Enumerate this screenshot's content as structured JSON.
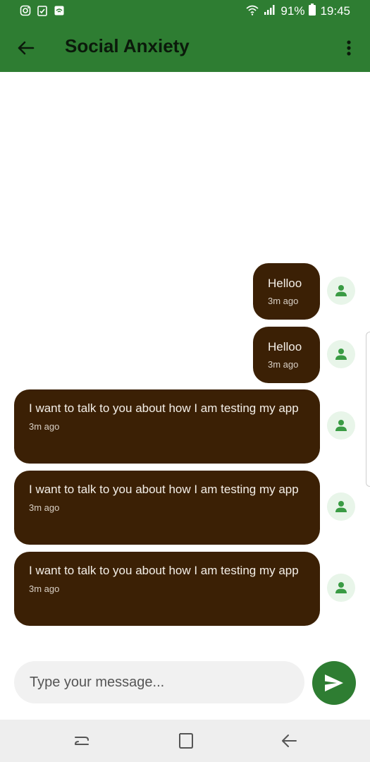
{
  "status_bar": {
    "left_icons": [
      "instagram-icon",
      "clipboard-icon",
      "message-icon"
    ],
    "battery": "91%",
    "time": "19:45"
  },
  "app_bar": {
    "title": "Social Anxiety",
    "back_icon": "arrow-left-icon",
    "menu_icon": "more-vert-icon",
    "color": "#2e7d32"
  },
  "messages": [
    {
      "text": "Helloo",
      "time": "3m ago"
    },
    {
      "text": "Helloo",
      "time": "3m ago"
    },
    {
      "text": "I want to talk to you about how I am testing my app",
      "time": "3m ago"
    },
    {
      "text": "I want to talk to you about how I am testing my app",
      "time": "3m ago"
    },
    {
      "text": "I want to talk to you about how I am testing my app",
      "time": "3m ago"
    }
  ],
  "bubble_color": "#3b2005",
  "avatar_icon": "person-icon",
  "composer": {
    "placeholder": "Type your message...",
    "send_icon": "send-icon"
  },
  "nav_bar": {
    "icons": [
      "recents-icon",
      "home-icon",
      "back-icon"
    ]
  }
}
